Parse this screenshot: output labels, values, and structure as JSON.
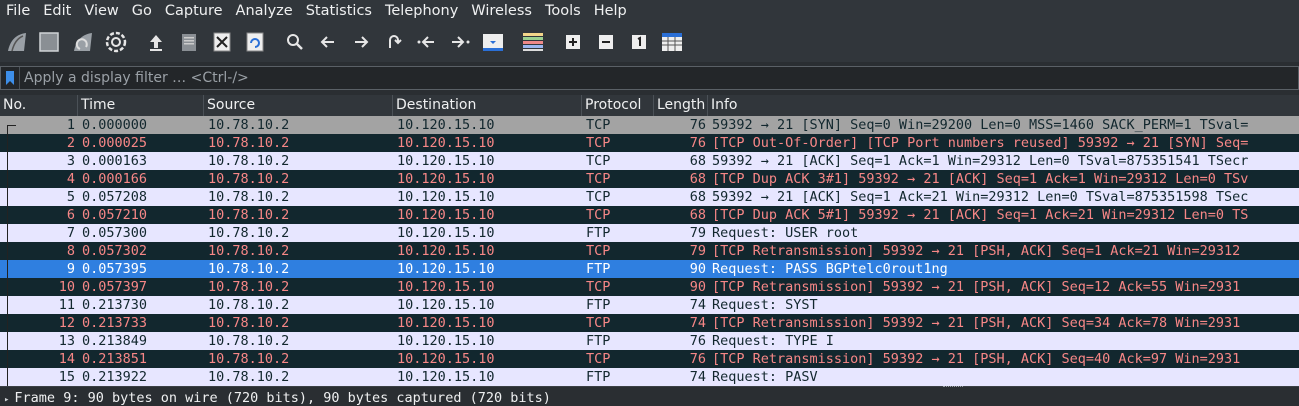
{
  "menu": [
    "File",
    "Edit",
    "View",
    "Go",
    "Capture",
    "Analyze",
    "Statistics",
    "Telephony",
    "Wireless",
    "Tools",
    "Help"
  ],
  "filter": {
    "placeholder": "Apply a display filter … <Ctrl-/>"
  },
  "columns": {
    "no": "No.",
    "time": "Time",
    "source": "Source",
    "destination": "Destination",
    "protocol": "Protocol",
    "length": "Length",
    "info": "Info"
  },
  "colors": {
    "tcp_ok_bg": "#e7e6ff",
    "tcp_ok_fg": "#12272e",
    "bad_bg": "#12272e",
    "bad_fg": "#f78787",
    "ftp_bg": "#e7e6ff",
    "first_bg": "#a3a3a3",
    "selected_bg": "#2f7fe0",
    "selected_fg": "#ffffff"
  },
  "packets": [
    {
      "no": "1",
      "time": "0.000000",
      "src": "10.78.10.2",
      "dst": "10.120.15.10",
      "proto": "TCP",
      "len": "76",
      "info": "59392 → 21 [SYN] Seq=0 Win=29200 Len=0 MSS=1460 SACK_PERM=1 TSval=",
      "style": "first"
    },
    {
      "no": "2",
      "time": "0.000025",
      "src": "10.78.10.2",
      "dst": "10.120.15.10",
      "proto": "TCP",
      "len": "76",
      "info": "[TCP Out-Of-Order] [TCP Port numbers reused] 59392 → 21 [SYN] Seq=",
      "style": "bad"
    },
    {
      "no": "3",
      "time": "0.000163",
      "src": "10.78.10.2",
      "dst": "10.120.15.10",
      "proto": "TCP",
      "len": "68",
      "info": "59392 → 21 [ACK] Seq=1 Ack=1 Win=29312 Len=0 TSval=875351541 TSecr",
      "style": "ok"
    },
    {
      "no": "4",
      "time": "0.000166",
      "src": "10.78.10.2",
      "dst": "10.120.15.10",
      "proto": "TCP",
      "len": "68",
      "info": "[TCP Dup ACK 3#1] 59392 → 21 [ACK] Seq=1 Ack=1 Win=29312 Len=0 TSv",
      "style": "bad"
    },
    {
      "no": "5",
      "time": "0.057208",
      "src": "10.78.10.2",
      "dst": "10.120.15.10",
      "proto": "TCP",
      "len": "68",
      "info": "59392 → 21 [ACK] Seq=1 Ack=21 Win=29312 Len=0 TSval=875351598 TSec",
      "style": "ok"
    },
    {
      "no": "6",
      "time": "0.057210",
      "src": "10.78.10.2",
      "dst": "10.120.15.10",
      "proto": "TCP",
      "len": "68",
      "info": "[TCP Dup ACK 5#1] 59392 → 21 [ACK] Seq=1 Ack=21 Win=29312 Len=0 TS",
      "style": "bad"
    },
    {
      "no": "7",
      "time": "0.057300",
      "src": "10.78.10.2",
      "dst": "10.120.15.10",
      "proto": "FTP",
      "len": "79",
      "info": "Request: USER root",
      "style": "ok"
    },
    {
      "no": "8",
      "time": "0.057302",
      "src": "10.78.10.2",
      "dst": "10.120.15.10",
      "proto": "TCP",
      "len": "79",
      "info": "[TCP Retransmission] 59392 → 21 [PSH, ACK] Seq=1 Ack=21 Win=29312",
      "style": "bad"
    },
    {
      "no": "9",
      "time": "0.057395",
      "src": "10.78.10.2",
      "dst": "10.120.15.10",
      "proto": "FTP",
      "len": "90",
      "info": "Request: PASS BGPtelc0rout1ng",
      "style": "selected"
    },
    {
      "no": "10",
      "time": "0.057397",
      "src": "10.78.10.2",
      "dst": "10.120.15.10",
      "proto": "TCP",
      "len": "90",
      "info": "[TCP Retransmission] 59392 → 21 [PSH, ACK] Seq=12 Ack=55 Win=2931",
      "style": "bad"
    },
    {
      "no": "11",
      "time": "0.213730",
      "src": "10.78.10.2",
      "dst": "10.120.15.10",
      "proto": "FTP",
      "len": "74",
      "info": "Request: SYST",
      "style": "ok"
    },
    {
      "no": "12",
      "time": "0.213733",
      "src": "10.78.10.2",
      "dst": "10.120.15.10",
      "proto": "TCP",
      "len": "74",
      "info": "[TCP Retransmission] 59392 → 21 [PSH, ACK] Seq=34 Ack=78 Win=2931",
      "style": "bad"
    },
    {
      "no": "13",
      "time": "0.213849",
      "src": "10.78.10.2",
      "dst": "10.120.15.10",
      "proto": "FTP",
      "len": "76",
      "info": "Request: TYPE I",
      "style": "ok"
    },
    {
      "no": "14",
      "time": "0.213851",
      "src": "10.78.10.2",
      "dst": "10.120.15.10",
      "proto": "TCP",
      "len": "76",
      "info": "[TCP Retransmission] 59392 → 21 [PSH, ACK] Seq=40 Ack=97 Win=2931",
      "style": "bad"
    },
    {
      "no": "15",
      "time": "0.213922",
      "src": "10.78.10.2",
      "dst": "10.120.15.10",
      "proto": "FTP",
      "len": "74",
      "info": "Request: PASV",
      "style": "ok"
    }
  ],
  "detail": {
    "frame_summary": "Frame 9: 90 bytes on wire (720 bits), 90 bytes captured (720 bits)"
  }
}
